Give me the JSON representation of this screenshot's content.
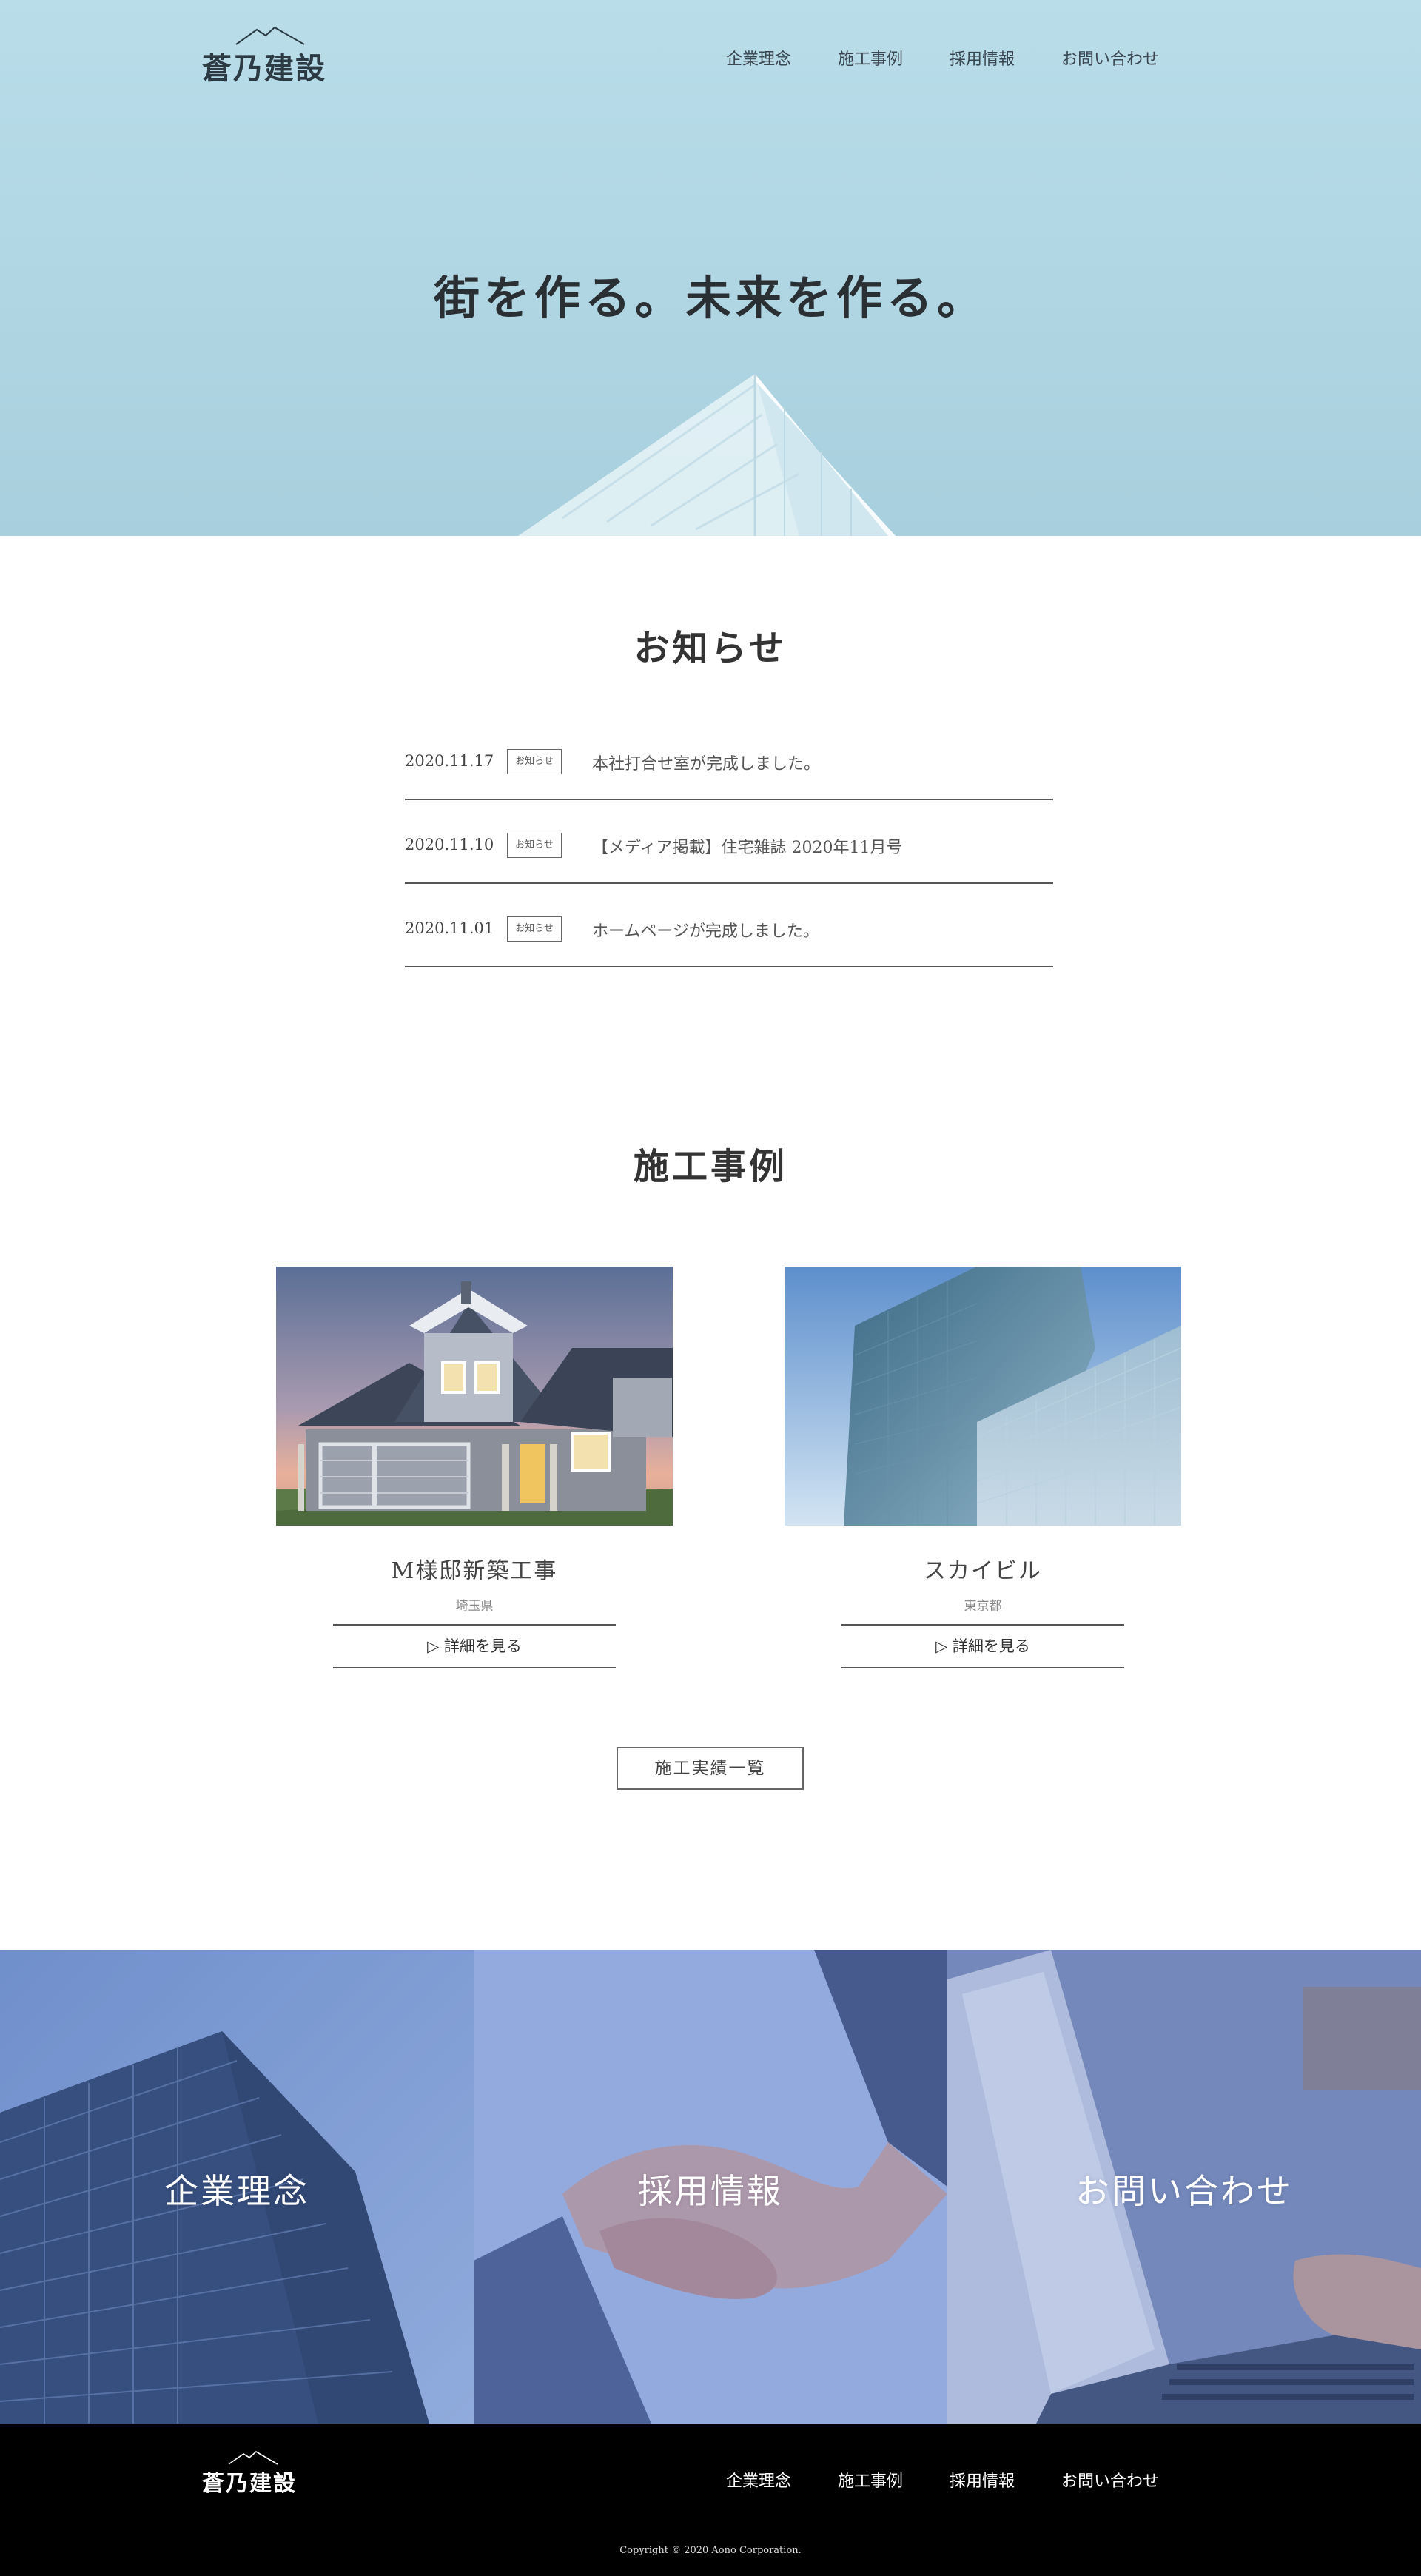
{
  "brand": {
    "name": "蒼乃建設"
  },
  "nav": [
    "企業理念",
    "施工事例",
    "採用情報",
    "お問い合わせ"
  ],
  "hero": {
    "title": "街を作る。未来を作る。"
  },
  "news": {
    "title": "お知らせ",
    "items": [
      {
        "date": "2020.11.17",
        "badge": "お知らせ",
        "text": "本社打合せ室が完成しました。"
      },
      {
        "date": "2020.11.10",
        "badge": "お知らせ",
        "text": "【メディア掲載】住宅雑誌 2020年11月号"
      },
      {
        "date": "2020.11.01",
        "badge": "お知らせ",
        "text": "ホームページが完成しました。"
      }
    ]
  },
  "works": {
    "title": "施工事例",
    "items": [
      {
        "title": "M様邸新築工事",
        "location": "埼玉県",
        "link": "▷ 詳細を見る"
      },
      {
        "title": "スカイビル",
        "location": "東京都",
        "link": "▷ 詳細を見る"
      }
    ],
    "all_button": "施工実績一覧"
  },
  "panels": [
    "企業理念",
    "採用情報",
    "お問い合わせ"
  ],
  "footer": {
    "nav": [
      "企業理念",
      "施工事例",
      "採用情報",
      "お問い合わせ"
    ],
    "copyright": "Copyright © 2020 Aono Corporation."
  },
  "colors": {
    "hero_bg": "#b9dde9",
    "footer_bg": "#000000",
    "panel_tint": "#5c7fc9"
  }
}
